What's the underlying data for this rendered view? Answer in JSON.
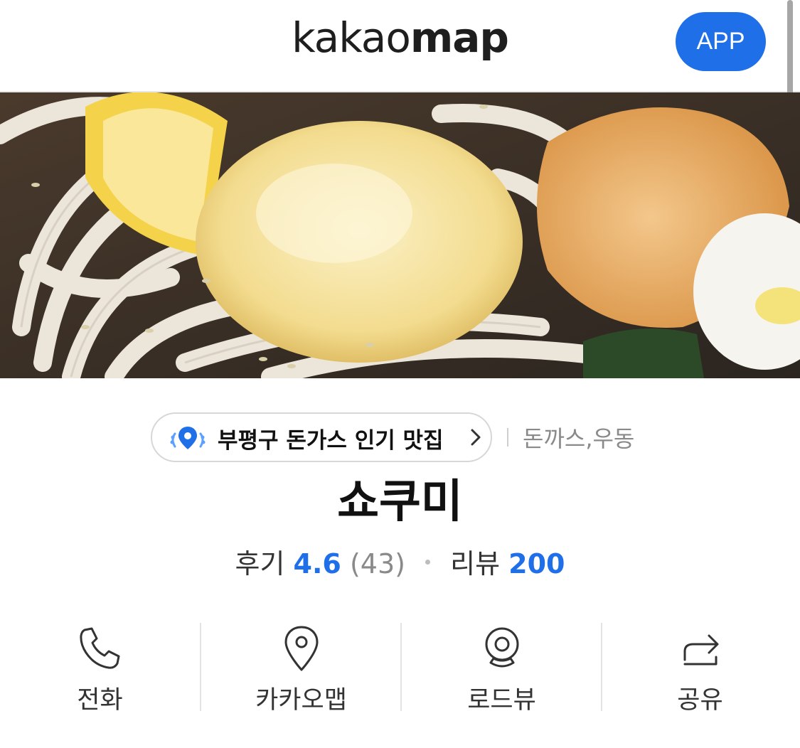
{
  "header": {
    "logo_part1": "kakao",
    "logo_part2": "map",
    "app_button": "APP"
  },
  "hero": {
    "image_description_icon": "food-photo"
  },
  "badge": {
    "label": "부평구 돈가스 인기 맛집",
    "icon": "pin-laurel-icon",
    "accent": "#1f6fe8"
  },
  "category": "돈까스,우동",
  "place_name": "쇼쿠미",
  "rating": {
    "review_label": "후기",
    "review_score": "4.6",
    "review_count": "(43)",
    "blog_label": "리뷰",
    "blog_count": "200"
  },
  "actions": [
    {
      "label": "전화",
      "icon": "phone-icon"
    },
    {
      "label": "카카오맵",
      "icon": "map-pin-icon"
    },
    {
      "label": "로드뷰",
      "icon": "roadview-icon"
    },
    {
      "label": "공유",
      "icon": "share-icon"
    }
  ],
  "colors": {
    "accent": "#1f6fe8",
    "text_primary": "#111111",
    "text_secondary": "#8a8a8a"
  }
}
